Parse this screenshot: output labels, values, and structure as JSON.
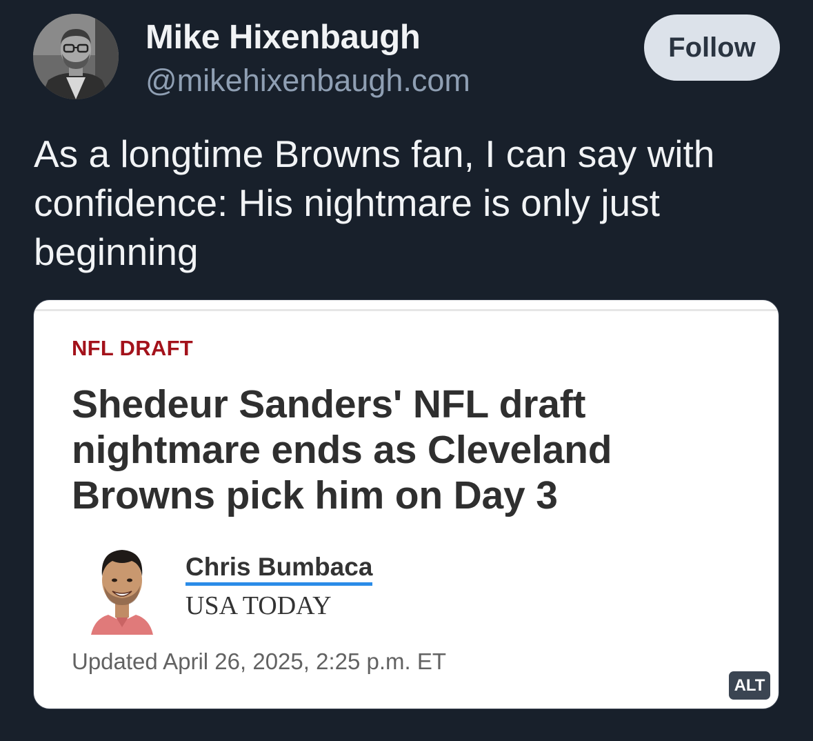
{
  "author": {
    "display_name": "Mike Hixenbaugh",
    "handle": "@mikehixenbaugh.com",
    "avatar_icon": "profile-photo"
  },
  "follow_label": "Follow",
  "post_text": "As a longtime Browns fan, I can say with confidence: His nightmare is only just beginning",
  "embed": {
    "kicker": "NFL DRAFT",
    "headline": "Shedeur Sanders' NFL draft nightmare ends as Cleveland Browns pick him on Day 3",
    "byline_name": "Chris Bumbaca",
    "publication": "USA TODAY",
    "updated": "Updated April 26, 2025, 2:25 p.m. ET",
    "alt_label": "ALT",
    "kicker_color": "#a3121b",
    "link_underline_color": "#2b8ce8"
  },
  "colors": {
    "background": "#18202b",
    "text": "#f1f3f5",
    "muted": "#8f9fb3",
    "follow_bg": "#dce2ea"
  }
}
